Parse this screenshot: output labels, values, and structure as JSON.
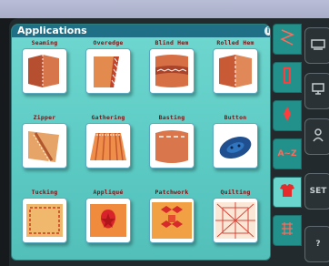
{
  "panel": {
    "title": "Applications",
    "info_glyph": "i"
  },
  "apps": [
    {
      "label": "Seaming",
      "icon": "seaming-icon"
    },
    {
      "label": "Overedge",
      "icon": "overedge-icon"
    },
    {
      "label": "Blind Hem",
      "icon": "blind-hem-icon"
    },
    {
      "label": "Rolled Hem",
      "icon": "rolled-hem-icon"
    },
    {
      "label": "Zipper",
      "icon": "zipper-icon"
    },
    {
      "label": "Gathering",
      "icon": "gathering-icon"
    },
    {
      "label": "Basting",
      "icon": "basting-icon"
    },
    {
      "label": "Button",
      "icon": "button-icon"
    },
    {
      "label": "Tucking",
      "icon": "tucking-icon"
    },
    {
      "label": "Appliqué",
      "icon": "applique-icon"
    },
    {
      "label": "Patchwork",
      "icon": "patchwork-icon"
    },
    {
      "label": "Quilting",
      "icon": "quilting-icon"
    }
  ],
  "tabs": [
    {
      "icon": "zigzag-stitch-icon",
      "text": ""
    },
    {
      "icon": "straight-stitch-icon",
      "text": ""
    },
    {
      "icon": "decorative-stitch-icon",
      "text": ""
    },
    {
      "icon": "alphabet-icon",
      "text": "A~Z"
    },
    {
      "icon": "garment-icon",
      "text": ""
    },
    {
      "icon": "quilt-stitch-icon",
      "text": ""
    }
  ],
  "side_buttons": [
    {
      "icon": "machine-icon",
      "text": ""
    },
    {
      "icon": "computer-icon",
      "text": ""
    },
    {
      "icon": "person-icon",
      "text": ""
    },
    {
      "icon": "settings-label",
      "text": "SET"
    },
    {
      "icon": "help-label",
      "text": "?"
    }
  ],
  "colors": {
    "panel_bg": "#5ccbc4",
    "header_bg": "#1f6f86",
    "label_text": "#7a1414",
    "fabric": "#c8603a",
    "active_tab": "#69d5cc"
  }
}
